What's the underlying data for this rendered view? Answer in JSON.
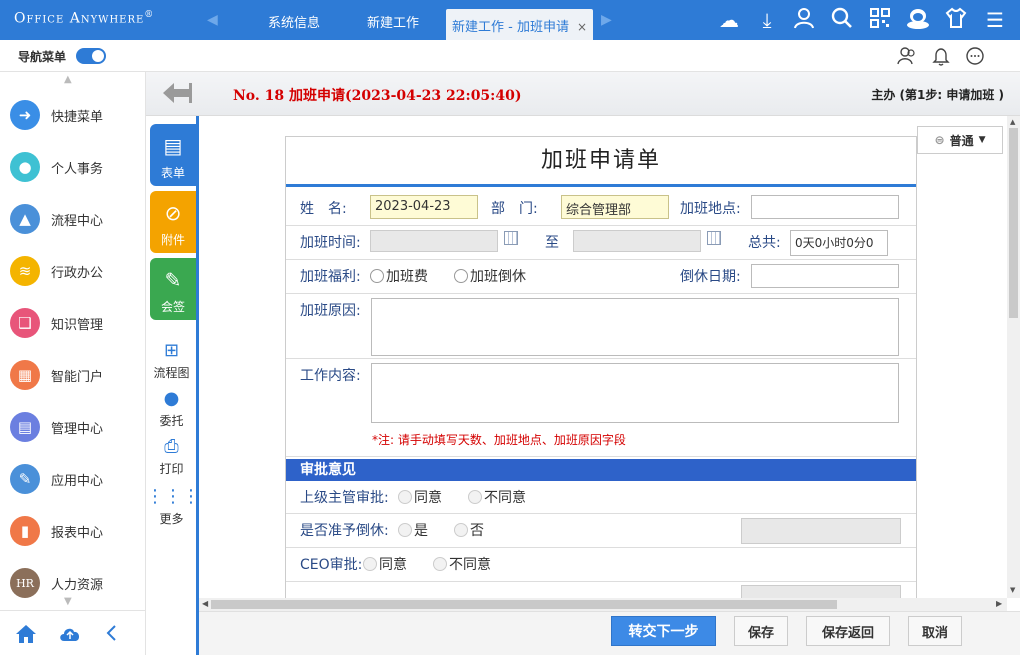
{
  "app": {
    "logo": "Office Anywhere",
    "logo_mark": "®"
  },
  "tabs": [
    {
      "label": "系统信息"
    },
    {
      "label": "新建工作"
    },
    {
      "label": "新建工作 - 加班申请",
      "close": "×"
    }
  ],
  "top_icons": [
    "cloud-icon",
    "download-icon",
    "user-icon",
    "search-icon",
    "qrcode-icon",
    "avatar-icon",
    "shirt-icon",
    "menu-icon"
  ],
  "bar2": {
    "nav_label": "导航菜单",
    "toggle_on": true
  },
  "sidebar": {
    "items": [
      {
        "label": "快捷菜单",
        "icon": "shortcut-icon",
        "color": "#3a8ee6"
      },
      {
        "label": "个人事务",
        "icon": "person-icon",
        "color": "#3ec1d3"
      },
      {
        "label": "流程中心",
        "icon": "flow-icon",
        "color": "#4a90d9"
      },
      {
        "label": "行政办公",
        "icon": "layers-icon",
        "color": "#f4b400"
      },
      {
        "label": "知识管理",
        "icon": "book-icon",
        "color": "#e8557a"
      },
      {
        "label": "智能门户",
        "icon": "portal-icon",
        "color": "#f07848"
      },
      {
        "label": "管理中心",
        "icon": "doc-icon",
        "color": "#6b7fe0"
      },
      {
        "label": "应用中心",
        "icon": "edit-icon",
        "color": "#4a90d9"
      },
      {
        "label": "报表中心",
        "icon": "chart-icon",
        "color": "#f07848"
      },
      {
        "label": "人力资源",
        "icon": "hr-icon",
        "color": "#8b6f5a",
        "text": "HR"
      }
    ]
  },
  "header": {
    "title": "No. 18 加班申请(2023-04-23 22:05:40)",
    "step": "主办 (第1步: 申请加班 )"
  },
  "tools": {
    "big": [
      {
        "label": "表单",
        "color": "#2e7bd6"
      },
      {
        "label": "附件",
        "color": "#f4a300"
      },
      {
        "label": "会签",
        "color": "#3aa850"
      }
    ],
    "small": [
      {
        "label": "流程图"
      },
      {
        "label": "委托"
      },
      {
        "label": "打印"
      },
      {
        "label": "更多"
      }
    ]
  },
  "priority": {
    "label": "普通"
  },
  "form": {
    "title": "加班申请单",
    "name_label": "姓　名:",
    "name_value": "2023-04-23",
    "dept_label": "部　门:",
    "dept_value": "综合管理部",
    "location_label": "加班地点:",
    "location_value": "",
    "time_label": "加班时间:",
    "to_label": "至",
    "total_label": "总共:",
    "total_value": "0天0小时0分0",
    "welfare_label": "加班福利:",
    "welfare_opt1": "加班费",
    "welfare_opt2": "加班倒休",
    "restdate_label": "倒休日期:",
    "reason_label": "加班原因:",
    "content_label": "工作内容:",
    "note": "*注: 请手动填写天数、加班地点、加班原因字段",
    "approval_section": "审批意见",
    "sup_label": "上级主管审批:",
    "agree": "同意",
    "disagree": "不同意",
    "rest_label": "是否准予倒休:",
    "yes": "是",
    "no": "否",
    "ceo_label": "CEO审批:"
  },
  "footer": {
    "submit": "转交下一步",
    "save": "保存",
    "save_return": "保存返回",
    "cancel": "取消"
  }
}
